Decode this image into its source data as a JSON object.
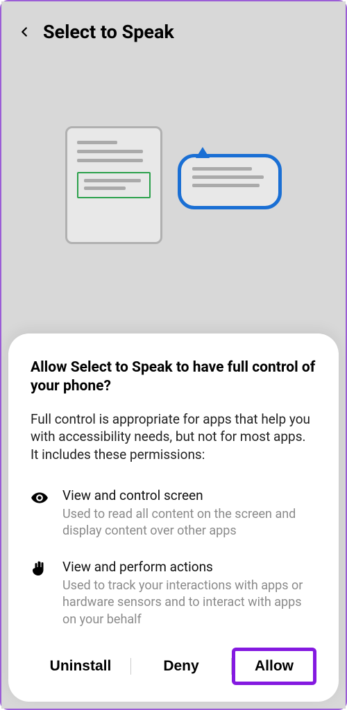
{
  "header": {
    "title": "Select to Speak"
  },
  "dialog": {
    "title": "Allow Select to Speak to have full control of your phone?",
    "body": "Full control is appropriate for apps that help you with accessibility needs, but not for most apps. It includes these permissions:",
    "permissions": [
      {
        "label": "View and control screen",
        "desc": "Used to read all content on the screen and display content over other apps"
      },
      {
        "label": "View and perform actions",
        "desc": "Used to track your interactions with apps or hardware sensors and to interact with apps on your behalf"
      }
    ],
    "buttons": {
      "uninstall": "Uninstall",
      "deny": "Deny",
      "allow": "Allow"
    }
  }
}
